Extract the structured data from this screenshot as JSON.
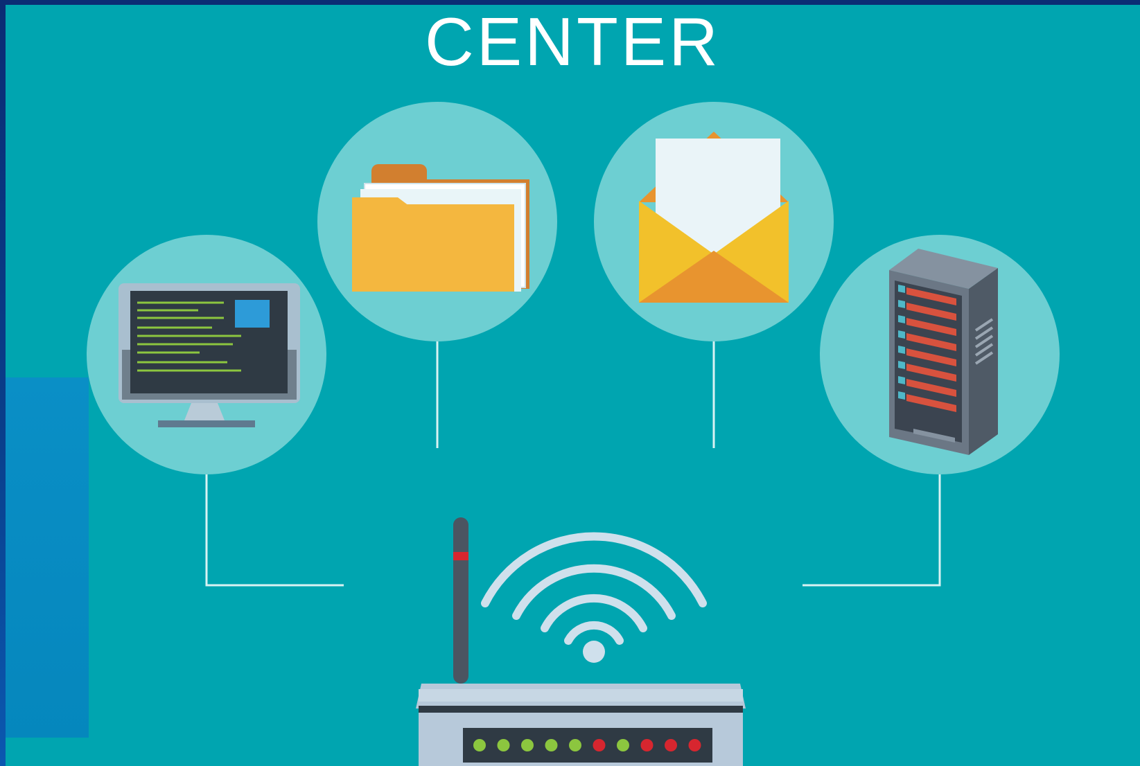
{
  "title": "CENTER",
  "colors": {
    "background": "#00a5b0",
    "circle": "#6dcfd2",
    "line": "#d9f2f3",
    "folder": "#f4b73f",
    "envelope": "#f2c12b",
    "led_green": "#8cc63f",
    "led_red": "#d7262f"
  },
  "nodes": [
    {
      "name": "monitor-icon"
    },
    {
      "name": "folder-icon"
    },
    {
      "name": "envelope-icon"
    },
    {
      "name": "server-rack-icon"
    }
  ],
  "router": {
    "icon": "wifi-router-icon",
    "leds": [
      "green",
      "green",
      "green",
      "green",
      "green",
      "red",
      "green",
      "red",
      "red",
      "red"
    ]
  }
}
